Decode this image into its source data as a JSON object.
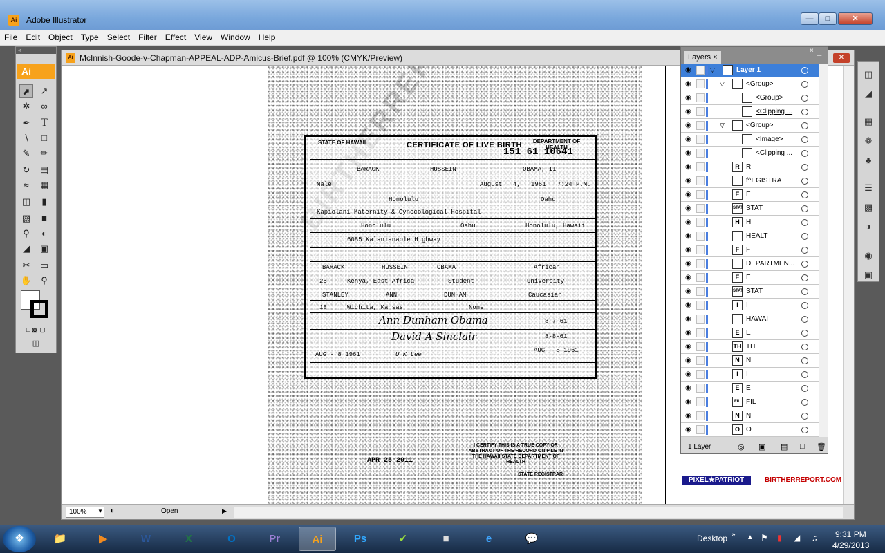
{
  "window": {
    "title": "Adobe Illustrator",
    "app_icon": "Ai"
  },
  "menu": [
    "File",
    "Edit",
    "Object",
    "Type",
    "Select",
    "Filter",
    "Effect",
    "View",
    "Window",
    "Help"
  ],
  "tools": {
    "badge": "Ai"
  },
  "document": {
    "title": "McInnish-Goode-v-Chapman-APPEAL-ADP-Amicus-Brief.pdf @ 100% (CMYK/Preview)",
    "zoom": "100%",
    "status": "Open"
  },
  "certificate": {
    "state_label": "STATE OF HAWAII",
    "title": "CERTIFICATE OF LIVE BIRTH",
    "dept": "DEPARTMENT OF HEALTH",
    "file_number": "151  61 10641",
    "name_first": "BARACK",
    "name_middle": "HUSSEIN",
    "name_last": "OBAMA, II",
    "sex": "Male",
    "birth_month": "August",
    "birth_day": "4,",
    "birth_year": "1961",
    "birth_time": "7:24 P.M.",
    "birth_city": "Honolulu",
    "birth_island": "Oahu",
    "hospital": "Kapiolani Maternity & Gynecological Hospital",
    "res_city": "Honolulu",
    "res_island": "Oahu",
    "res_state": "Honolulu, Hawaii",
    "street": "6085 Kalanianaole Highway",
    "father_name": "BARACK",
    "father_middle": "HUSSEIN",
    "father_last": "OBAMA",
    "father_race": "African",
    "father_age": "25",
    "father_birthplace": "Kenya, East Africa",
    "father_occupation": "Student",
    "father_business": "University",
    "mother_first": "STANLEY",
    "mother_middle": "ANN",
    "mother_last": "DUNHAM",
    "mother_race": "Caucasian",
    "mother_age": "18",
    "mother_birthplace": "Wichita, Kansas",
    "mother_occupation": "None",
    "sig_parent": "Ann Dunham Obama",
    "sig_date1": "8-7-61",
    "sig_attendant": "David A Sinclair",
    "sig_date2": "8-8-61",
    "date_accepted": "AUG - 8 1961",
    "registrar_sig": "U K Lee",
    "registrar_date": "AUG - 8 1961",
    "watermark": "BIRTHERREPORT.COM",
    "certify_text": "I CERTIFY THIS IS A TRUE COPY OR ABSTRACT OF THE RECORD ON FILE IN THE HAWAII STATE DEPARTMENT OF HEALTH",
    "issue_date": "APR 25 2011",
    "registrar_title": "STATE REGISTRAR"
  },
  "layers": {
    "tab": "Layers",
    "count_label": "1 Layer",
    "rows": [
      {
        "name": "Layer 1",
        "thumb": "",
        "level": 0,
        "selected": true
      },
      {
        "name": "<Group>",
        "thumb": "",
        "level": 1
      },
      {
        "name": "<Group>",
        "thumb": "",
        "level": 2
      },
      {
        "name": "<Clipping ...",
        "thumb": "",
        "level": 2
      },
      {
        "name": "<Group>",
        "thumb": "",
        "level": 1
      },
      {
        "name": "<Image>",
        "thumb": "",
        "level": 2
      },
      {
        "name": "<Clipping ...",
        "thumb": "",
        "level": 2
      },
      {
        "name": "R",
        "thumb": "R",
        "level": 1
      },
      {
        "name": "f^EGISTRA",
        "thumb": "",
        "level": 1
      },
      {
        "name": "E",
        "thumb": "E",
        "level": 1
      },
      {
        "name": "STAT",
        "thumb": "STAT",
        "level": 1
      },
      {
        "name": "H",
        "thumb": "H",
        "level": 1
      },
      {
        "name": "HEALT",
        "thumb": "",
        "level": 1
      },
      {
        "name": "F",
        "thumb": "F",
        "level": 1
      },
      {
        "name": "DEPARTMEN...",
        "thumb": "",
        "level": 1
      },
      {
        "name": "E",
        "thumb": "E",
        "level": 1
      },
      {
        "name": "STAT",
        "thumb": "STAT",
        "level": 1
      },
      {
        "name": "I",
        "thumb": "I",
        "level": 1
      },
      {
        "name": "HAWAI",
        "thumb": "",
        "level": 1
      },
      {
        "name": "E",
        "thumb": "E",
        "level": 1
      },
      {
        "name": "TH",
        "thumb": "TH",
        "level": 1
      },
      {
        "name": "N",
        "thumb": "N",
        "level": 1
      },
      {
        "name": "I",
        "thumb": "I",
        "level": 1
      },
      {
        "name": "E",
        "thumb": "E",
        "level": 1
      },
      {
        "name": "FIL",
        "thumb": "FIL",
        "level": 1
      },
      {
        "name": "N",
        "thumb": "N",
        "level": 1
      },
      {
        "name": "O",
        "thumb": "O",
        "level": 1
      }
    ]
  },
  "logos": {
    "pixel": "PIXEL★PATRIOT",
    "birther": "BIRTHERREPORT.COM"
  },
  "taskbar": {
    "apps": [
      {
        "label": "📁",
        "name": "explorer",
        "color": "#f0c040"
      },
      {
        "label": "▶",
        "name": "media-player",
        "color": "#f08a20"
      },
      {
        "label": "W",
        "name": "word",
        "color": "#2b579a"
      },
      {
        "label": "X",
        "name": "excel",
        "color": "#217346"
      },
      {
        "label": "O",
        "name": "outlook",
        "color": "#0072c6"
      },
      {
        "label": "Pr",
        "name": "premiere",
        "color": "#9b7fd4"
      },
      {
        "label": "Ai",
        "name": "illustrator",
        "color": "#f7a21b",
        "active": true
      },
      {
        "label": "Ps",
        "name": "photoshop",
        "color": "#31a8ff"
      },
      {
        "label": "✓",
        "name": "nike",
        "color": "#9be03c"
      },
      {
        "label": "■",
        "name": "printer",
        "color": "#ddd"
      },
      {
        "label": "e",
        "name": "internet-explorer",
        "color": "#3fa6ff"
      },
      {
        "label": "💬",
        "name": "chat",
        "color": "#ffd24a"
      }
    ],
    "desktop_label": "Desktop",
    "time": "9:31 PM",
    "date": "4/29/2013"
  }
}
